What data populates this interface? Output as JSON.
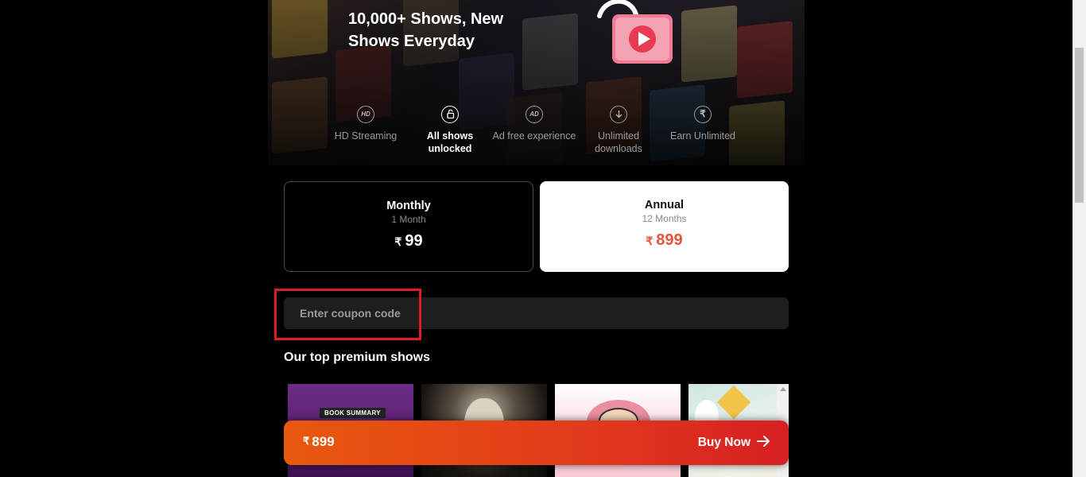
{
  "hero": {
    "title": "10,000+ Shows, New Shows Everyday",
    "features": [
      {
        "icon": "HD",
        "label": "HD Streaming",
        "active": false
      },
      {
        "icon": "lock-open",
        "label": "All shows unlocked",
        "active": true
      },
      {
        "icon": "AD",
        "label": "Ad free experience",
        "active": false
      },
      {
        "icon": "download",
        "label": "Unlimited downloads",
        "active": false
      },
      {
        "icon": "rupee",
        "label": "Earn Unlimited",
        "active": false
      }
    ]
  },
  "plans": {
    "monthly": {
      "name": "Monthly",
      "duration": "1 Month",
      "currency": "₹",
      "price": "99"
    },
    "annual": {
      "name": "Annual",
      "duration": "12 Months",
      "currency": "₹",
      "price": "899"
    }
  },
  "coupon": {
    "placeholder": "Enter coupon code"
  },
  "shows": {
    "title": "Our top premium shows",
    "book_tag": "BOOK SUMMARY"
  },
  "buy": {
    "currency": "₹",
    "price": "899",
    "label": "Buy Now"
  },
  "colors": {
    "accent": "#e8543a",
    "buy_start": "#e8580e",
    "buy_end": "#d61f23",
    "highlight": "#e21b23"
  }
}
